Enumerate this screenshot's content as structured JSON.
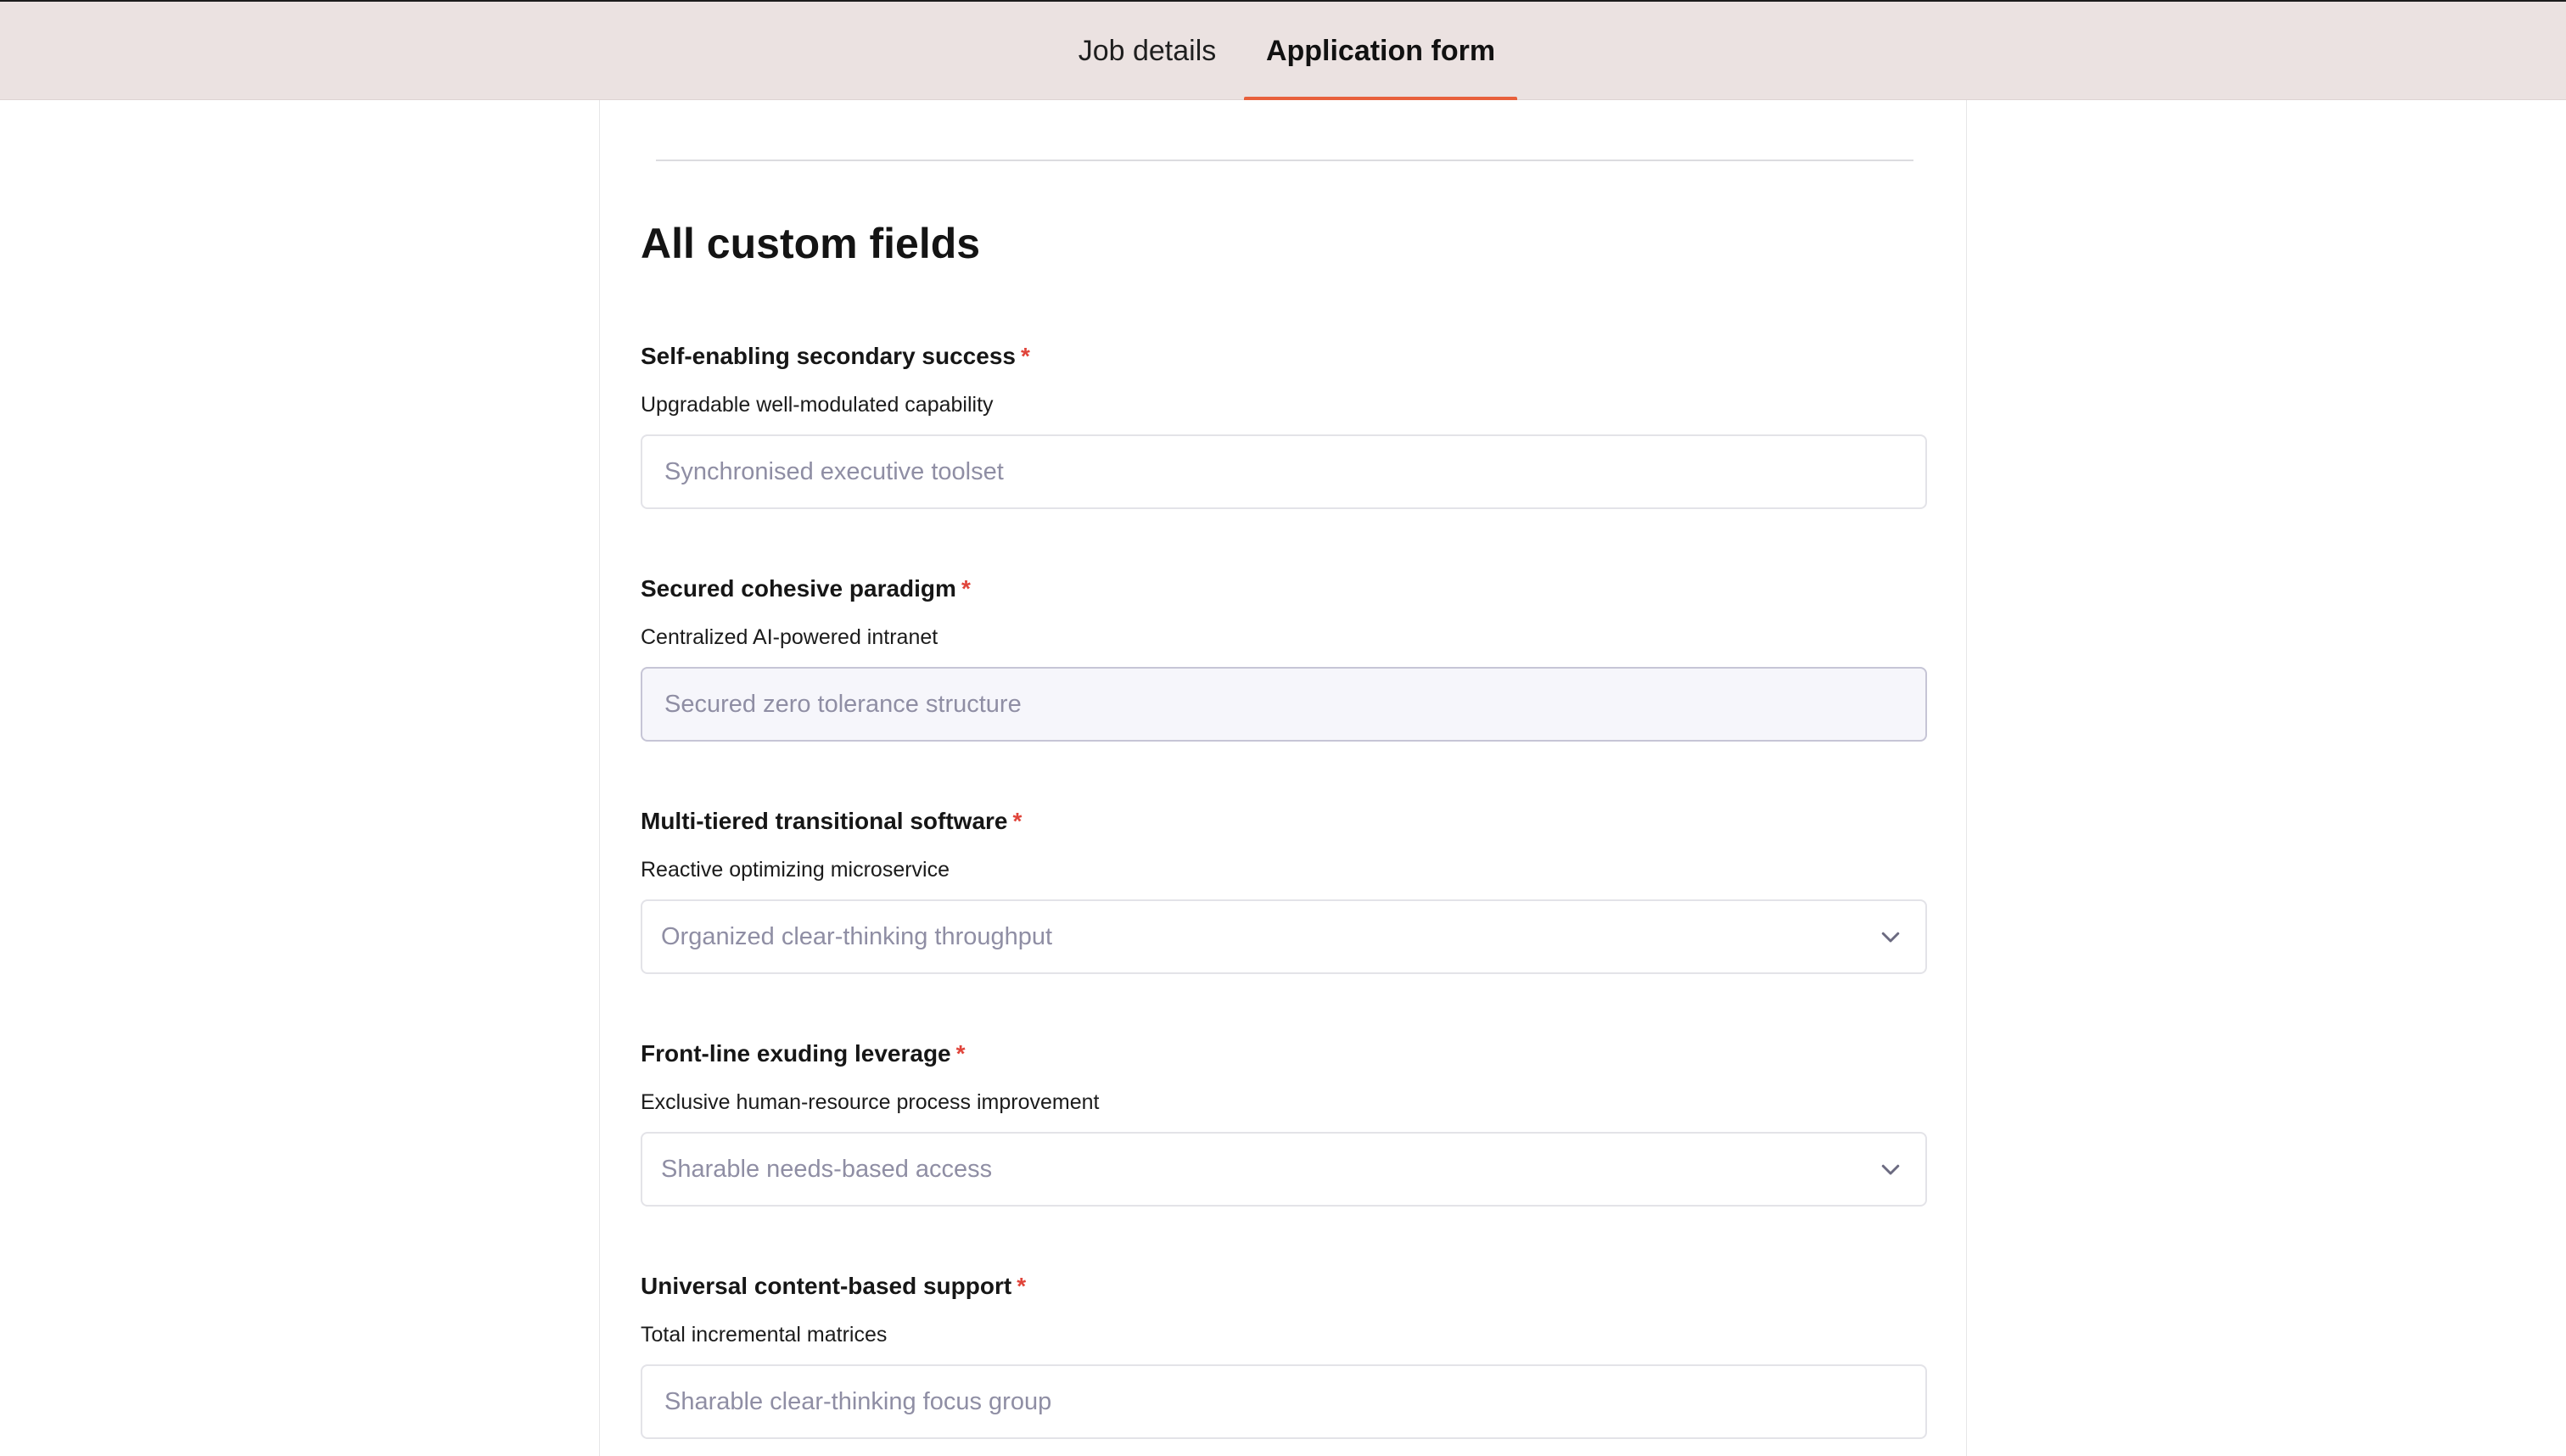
{
  "tabs": {
    "job_details": "Job details",
    "application_form": "Application form"
  },
  "form": {
    "section_title": "All custom fields",
    "required_marker": "*",
    "fields": [
      {
        "label": "Self-enabling secondary success",
        "help": "Upgradable well-modulated capability",
        "type": "text",
        "placeholder": "Synchronised executive toolset"
      },
      {
        "label": "Secured cohesive paradigm",
        "help": "Centralized AI-powered intranet",
        "type": "text",
        "placeholder": "Secured zero tolerance structure"
      },
      {
        "label": "Multi-tiered transitional software",
        "help": "Reactive optimizing microservice",
        "type": "select",
        "placeholder": "Organized clear-thinking throughput",
        "icon": "chevron-down-icon"
      },
      {
        "label": "Front-line exuding leverage",
        "help": "Exclusive human-resource process improvement",
        "type": "select",
        "placeholder": "Sharable needs-based access",
        "icon": "chevron-down-icon"
      },
      {
        "label": "Universal content-based support",
        "help": "Total incremental matrices",
        "type": "text",
        "placeholder": "Sharable clear-thinking focus group"
      }
    ]
  },
  "colors": {
    "tab_bar_bg": "#ebe2e1",
    "active_tab_underline": "#e8603c",
    "required_marker": "#e0443a",
    "placeholder_text": "#8f8ea4"
  }
}
